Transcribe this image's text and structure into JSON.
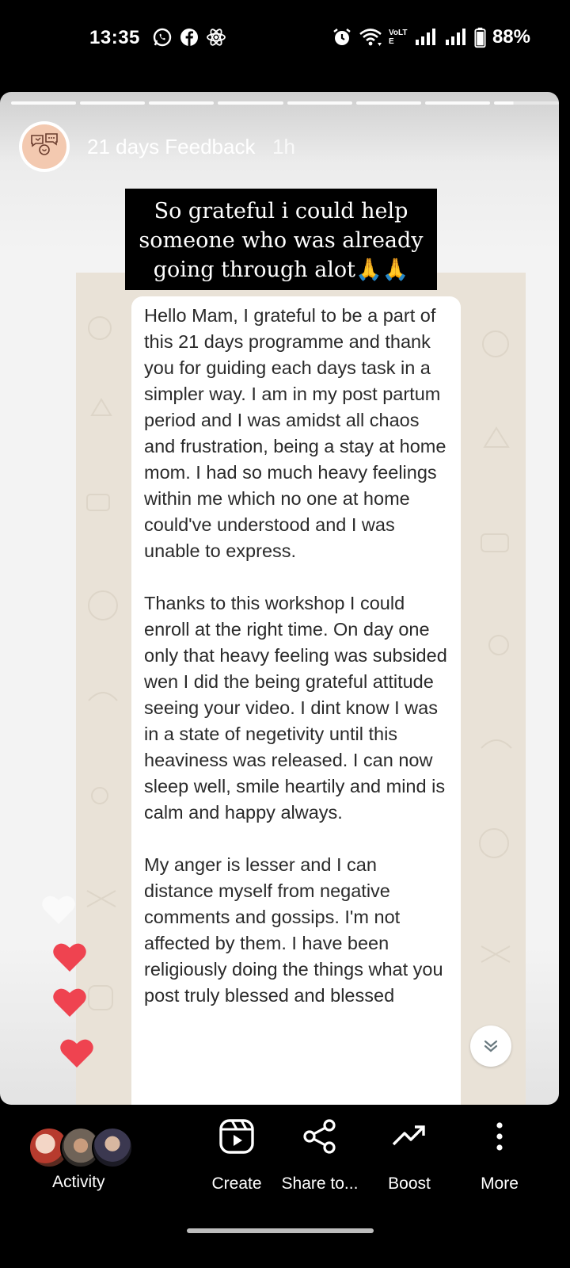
{
  "status_bar": {
    "time": "13:35",
    "battery": "88%",
    "left_icons": [
      "whatsapp-icon",
      "facebook-icon",
      "react-icon"
    ],
    "right_icons": [
      "alarm-icon",
      "wifi-icon",
      "volte-icon",
      "signal-icon",
      "signal-icon",
      "battery-icon"
    ],
    "volte_text": "VoLTE"
  },
  "story": {
    "progress_segments": 8,
    "current_segment": 8,
    "current_segment_progress": 0.3,
    "account_name": "21 days Feedback",
    "posted_ago": "1h",
    "avatar_text": "Feedback",
    "caption": "So grateful i could help someone who was already going through alot🙏🙏",
    "message_paragraphs": [
      "Hello Mam, I grateful to be a part of this 21 days programme and thank you for guiding each days task in a simpler way. I am in my post partum period and I was amidst all chaos and frustration, being a stay at home mom. I had so much heavy feelings within me which no one at home could've understood and I was unable to express.",
      "Thanks to this workshop I could enroll at the right time. On day one only that heavy feeling was subsided wen I did the being grateful attitude seeing your video. I dint know I was in a state of negetivity until this heaviness was released. I can now sleep well, smile heartily and mind is calm and happy always.",
      "My anger is lesser and I can distance myself from negative comments and gossips. I'm not affected by them. I have been religiously doing the things what you post truly blessed and blessed"
    ],
    "scroll_icon": "double-chevron-down-icon",
    "heart_color": "#ef4350",
    "accent_colors": {
      "caption_bg": "#000000",
      "bubble_bg": "#ffffff",
      "chat_bg": "#e9e2d7"
    }
  },
  "bottom_bar": {
    "activity_label": "Activity",
    "actions": [
      {
        "label": "Create",
        "icon": "reel-play-icon"
      },
      {
        "label": "Share to...",
        "icon": "share-icon"
      },
      {
        "label": "Boost",
        "icon": "trend-up-icon"
      },
      {
        "label": "More",
        "icon": "more-vertical-icon"
      }
    ]
  }
}
